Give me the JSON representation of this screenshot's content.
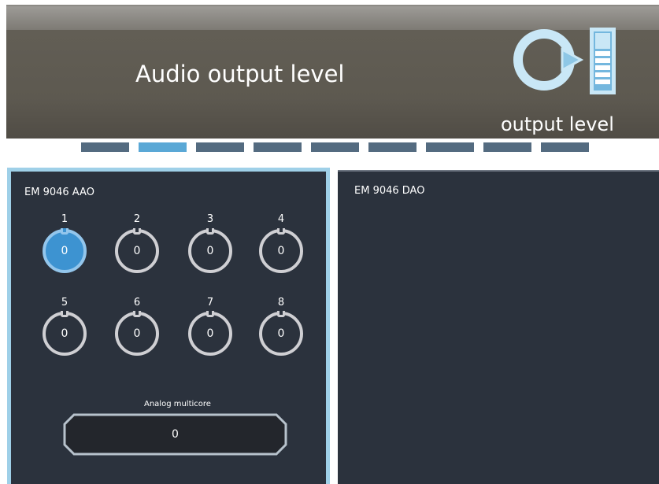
{
  "header": {
    "title": "Audio output level",
    "subtitle": "output level",
    "icon": "output-level-icon"
  },
  "pager": {
    "count": 9,
    "active_index": 1
  },
  "left_panel": {
    "title": "EM 9046 AAO",
    "channels": [
      {
        "label": "1",
        "value": "0"
      },
      {
        "label": "2",
        "value": "0"
      },
      {
        "label": "3",
        "value": "0"
      },
      {
        "label": "4",
        "value": "0"
      },
      {
        "label": "5",
        "value": "0"
      },
      {
        "label": "6",
        "value": "0"
      },
      {
        "label": "7",
        "value": "0"
      },
      {
        "label": "8",
        "value": "0"
      }
    ],
    "selected_channel": "1",
    "multicore": {
      "label": "Analog multicore",
      "value": "0"
    }
  },
  "right_panel": {
    "title": "EM 9046 DAO"
  },
  "colors": {
    "accent": "#5aa8d6",
    "panel_bg": "#2b323d",
    "panel_border": "#9fd0e8",
    "header_bg": "#5d5950"
  }
}
